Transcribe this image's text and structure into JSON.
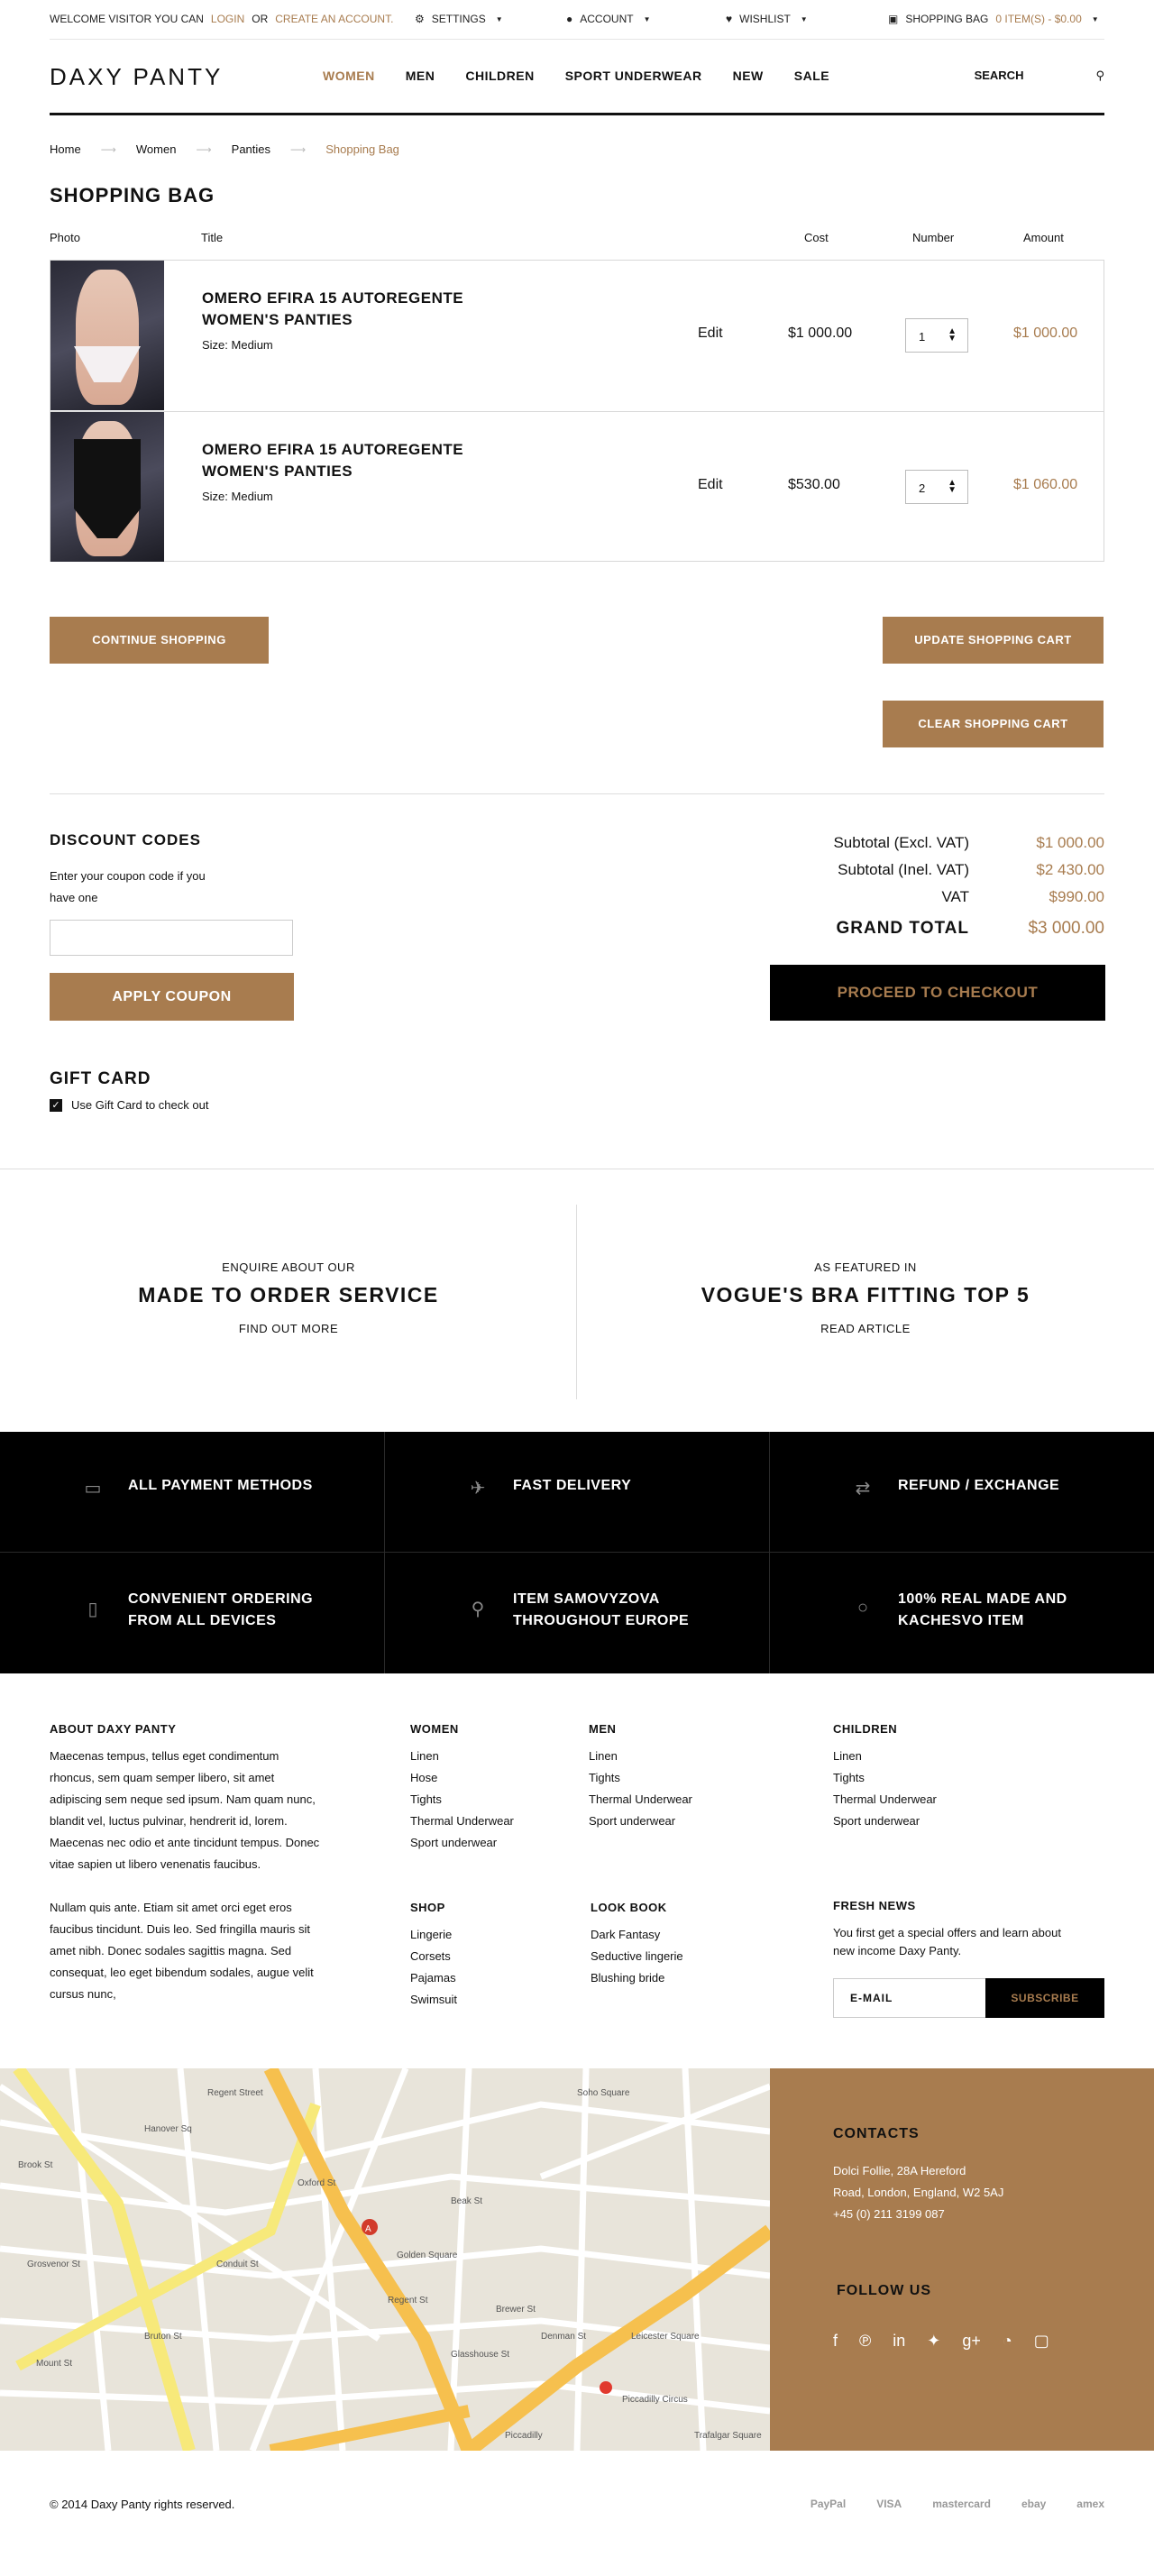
{
  "topbar": {
    "welcome": "WELCOME VISITOR YOU CAN",
    "login": "LOGIN",
    "or": "OR",
    "create": "CREATE AN ACCOUNT.",
    "settings": "SETTINGS",
    "account": "ACCOUNT",
    "wishlist": "WISHLIST",
    "bag": "SHOPPING BAG",
    "bag_count": "0 ITEM(S) - $0.00"
  },
  "header": {
    "logo": "DAXY PANTY",
    "nav": [
      "WOMEN",
      "MEN",
      "CHILDREN",
      "SPORT UNDERWEAR",
      "NEW",
      "SALE"
    ],
    "search": "SEARCH"
  },
  "breadcrumb": [
    "Home",
    "Women",
    "Panties",
    "Shopping Bag"
  ],
  "page_title": "SHOPPING BAG",
  "table": {
    "headers": [
      "Photo",
      "Title",
      "Cost",
      "Number",
      "Amount"
    ],
    "rows": [
      {
        "name": "OMERO EFIRA 15 AUTOREGENTE WOMEN'S PANTIES",
        "size": "Size: Medium",
        "edit": "Edit",
        "cost": "$1 000.00",
        "qty": "1",
        "amount": "$1 000.00"
      },
      {
        "name": "OMERO EFIRA 15 AUTOREGENTE WOMEN'S PANTIES",
        "size": "Size: Medium",
        "edit": "Edit",
        "cost": "$530.00",
        "qty": "2",
        "amount": "$1 060.00"
      }
    ]
  },
  "buttons": {
    "continue": "CONTINUE SHOPPING",
    "update": "UPDATE SHOPPING CART",
    "clear": "CLEAR SHOPPING CART",
    "apply": "APPLY COUPON",
    "checkout": "PROCEED TO CHECKOUT"
  },
  "discount": {
    "title": "DISCOUNT CODES",
    "text": "Enter your coupon code if you have one"
  },
  "totals": {
    "subtotal_excl_label": "Subtotal (Excl. VAT)",
    "subtotal_excl": "$1 000.00",
    "subtotal_incl_label": "Subtotal (Inel. VAT)",
    "subtotal_incl": "$2 430.00",
    "vat_label": "VAT",
    "vat": "$990.00",
    "grand_label": "GRAND TOTAL",
    "grand": "$3 000.00"
  },
  "gift": {
    "title": "GIFT CARD",
    "label": "Use Gift Card to check out"
  },
  "promo": [
    {
      "kicker": "ENQUIRE ABOUT OUR",
      "headline": "MADE TO ORDER SERVICE",
      "link": "FIND OUT MORE"
    },
    {
      "kicker": "AS FEATURED IN",
      "headline": "VOGUE'S BRA FITTING TOP 5",
      "link": "READ ARTICLE"
    }
  ],
  "features": [
    {
      "icon": "credit-card-icon",
      "line1": "ALL PAYMENT METHODS",
      "line2": ""
    },
    {
      "icon": "airplane-icon",
      "line1": "FAST DELIVERY",
      "line2": ""
    },
    {
      "icon": "exchange-icon",
      "line1": "REFUND / EXCHANGE",
      "line2": ""
    },
    {
      "icon": "mobile-icon",
      "line1": "CONVENIENT ORDERING",
      "line2": "FROM ALL DEVICES"
    },
    {
      "icon": "map-pin-icon",
      "line1": "ITEM SAMOVYZOVA",
      "line2": "THROUGHOUT EUROPE"
    },
    {
      "icon": "circle-icon",
      "line1": "100% REAL MADE AND",
      "line2": "KACHESVO ITEM"
    }
  ],
  "footer": {
    "about_title": "ABOUT DAXY PANTY",
    "about_p1": "Maecenas tempus, tellus eget condimentum rhoncus, sem quam semper libero, sit amet adipiscing sem neque sed ipsum. Nam quam nunc, blandit vel, luctus pulvinar, hendrerit id, lorem. Maecenas nec odio et ante tincidunt tempus. Donec vitae sapien ut libero venenatis faucibus.",
    "about_p2": "Nullam quis ante. Etiam sit amet orci eget eros faucibus tincidunt. Duis leo. Sed fringilla mauris sit amet nibh. Donec sodales sagittis magna. Sed consequat, leo eget bibendum sodales, augue velit cursus nunc,",
    "women_title": "WOMEN",
    "women": [
      "Linen",
      "Hose",
      "Tights",
      "Thermal Underwear",
      "Sport underwear"
    ],
    "men_title": "MEN",
    "men": [
      "Linen",
      "Tights",
      "Thermal Underwear",
      "Sport underwear"
    ],
    "children_title": "CHILDREN",
    "children": [
      "Linen",
      "Tights",
      "Thermal Underwear",
      "Sport underwear"
    ],
    "shop_title": "SHOP",
    "shop": [
      "Lingerie",
      "Corsets",
      "Pajamas",
      "Swimsuit"
    ],
    "look_title": "LOOK BOOK",
    "look": [
      "Dark Fantasy",
      "Seductive lingerie",
      "Blushing bride"
    ],
    "news_title": "FRESH NEWS",
    "news_text": "You first get a special offers and learn about new income Daxy Panty.",
    "email_placeholder": "E-MAIL",
    "subscribe": "SUBSCRIBE"
  },
  "contacts": {
    "title": "CONTACTS",
    "address1": "Dolci Follie, 28A Hereford",
    "address2": "Road, London, England, W2 5AJ",
    "phone": "+45 (0) 211 3199 087",
    "follow": "FOLLOW US"
  },
  "map_labels": [
    "Regent Street",
    "Hanover Sq",
    "Brook St",
    "Oxford St",
    "Regent St",
    "Soho Square",
    "Piccadilly Circus",
    "Leicester Square",
    "Trafalgar Square",
    "Glasshouse St",
    "Golden Square",
    "Brewer St",
    "Beak St",
    "Denman St",
    "Conduit St",
    "Bruton St",
    "Grosvenor St",
    "Mount St",
    "Piccadilly"
  ],
  "copyright": "© 2014 Daxy Panty rights reserved.",
  "payments": [
    "PayPal",
    "VISA",
    "mastercard",
    "ebay",
    "amex"
  ],
  "colors": {
    "accent": "#a87c4f",
    "dark": "#000000"
  }
}
